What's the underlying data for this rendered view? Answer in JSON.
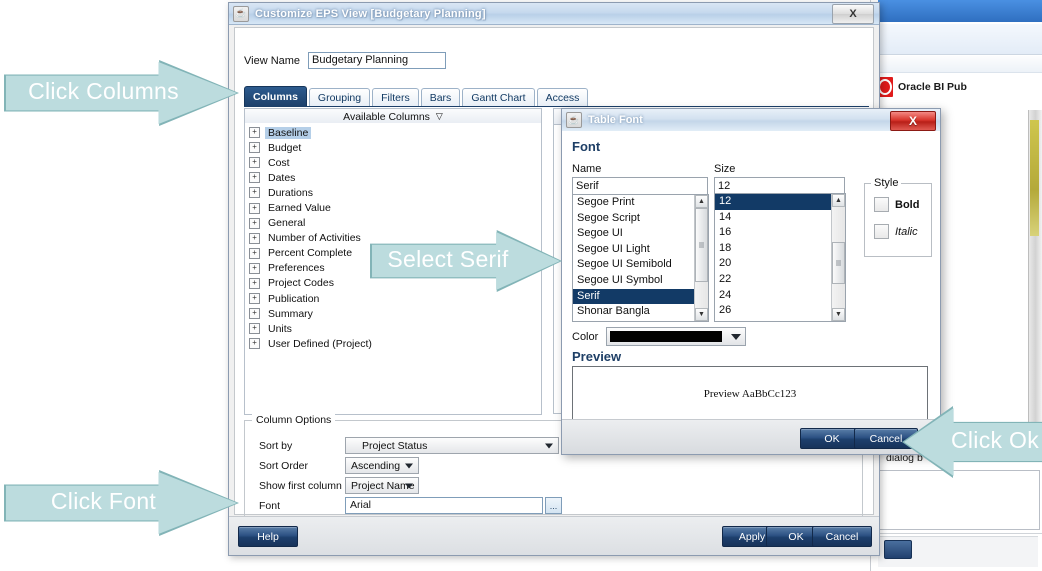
{
  "background_app": {
    "oracle_label": "Oracle BI Pub",
    "dialog_text": "dialog b"
  },
  "eps_dialog": {
    "title": "Customize EPS View [Budgetary Planning]",
    "title_icon": "java-cup-icon",
    "close_label": "X",
    "view_name_label": "View Name",
    "view_name_value": "Budgetary Planning",
    "tabs": [
      {
        "label": "Columns",
        "active": true
      },
      {
        "label": "Grouping",
        "active": false
      },
      {
        "label": "Filters",
        "active": false
      },
      {
        "label": "Bars",
        "active": false
      },
      {
        "label": "Gantt Chart",
        "active": false
      },
      {
        "label": "Access",
        "active": false
      }
    ],
    "available_columns_header": "Available Columns",
    "available_columns_sort_glyph": "▽",
    "available_columns": [
      {
        "label": "Baseline",
        "selected": true
      },
      {
        "label": "Budget",
        "selected": false
      },
      {
        "label": "Cost",
        "selected": false
      },
      {
        "label": "Dates",
        "selected": false
      },
      {
        "label": "Durations",
        "selected": false
      },
      {
        "label": "Earned Value",
        "selected": false
      },
      {
        "label": "General",
        "selected": false
      },
      {
        "label": "Number of Activities",
        "selected": false
      },
      {
        "label": "Percent Complete",
        "selected": false
      },
      {
        "label": "Preferences",
        "selected": false
      },
      {
        "label": "Project Codes",
        "selected": false
      },
      {
        "label": "Publication",
        "selected": false
      },
      {
        "label": "Summary",
        "selected": false
      },
      {
        "label": "Units",
        "selected": false
      },
      {
        "label": "User Defined (Project)",
        "selected": false
      }
    ],
    "column_options": {
      "legend": "Column Options",
      "sort_by_label": "Sort by",
      "sort_by_value": "Project Status",
      "sort_order_label": "Sort Order",
      "sort_order_value": "Ascending",
      "show_first_column_label": "Show first column as",
      "show_first_column_value": "Project Name",
      "font_label": "Font",
      "font_value": "Arial",
      "font_browse_label": "..."
    },
    "footer": {
      "help": "Help",
      "apply": "Apply",
      "ok": "OK",
      "cancel": "Cancel"
    }
  },
  "font_dialog": {
    "title": "Table Font",
    "title_icon": "java-cup-icon",
    "close_label": "X",
    "section_title": "Font",
    "name_label": "Name",
    "name_value": "Serif",
    "name_options": [
      {
        "label": "Segoe Print",
        "selected": false
      },
      {
        "label": "Segoe Script",
        "selected": false
      },
      {
        "label": "Segoe UI",
        "selected": false
      },
      {
        "label": "Segoe UI Light",
        "selected": false
      },
      {
        "label": "Segoe UI Semibold",
        "selected": false
      },
      {
        "label": "Segoe UI Symbol",
        "selected": false
      },
      {
        "label": "Serif",
        "selected": true
      },
      {
        "label": "Shonar Bangla",
        "selected": false
      }
    ],
    "size_label": "Size",
    "size_value": "12",
    "size_options": [
      {
        "label": "12",
        "selected": true
      },
      {
        "label": "14",
        "selected": false
      },
      {
        "label": "16",
        "selected": false
      },
      {
        "label": "18",
        "selected": false
      },
      {
        "label": "20",
        "selected": false
      },
      {
        "label": "22",
        "selected": false
      },
      {
        "label": "24",
        "selected": false
      },
      {
        "label": "26",
        "selected": false
      }
    ],
    "style_legend": "Style",
    "bold_label": "Bold",
    "bold_checked": false,
    "italic_label": "Italic",
    "italic_checked": false,
    "color_label": "Color",
    "color_value": "#000000",
    "preview_label": "Preview",
    "preview_text": "Preview AaBbCc123",
    "ok": "OK",
    "cancel": "Cancel"
  },
  "callouts": {
    "click_columns": "Click Columns",
    "click_font": "Click Font",
    "select_serif": "Select Serif",
    "click_ok": "Click Ok"
  },
  "colors": {
    "callout_fill": "#bcdcde",
    "callout_border": "#82b4b7",
    "selection_blue": "#123a66",
    "tab_active": "#1c3f69",
    "oracle_red": "#e01b1b"
  }
}
